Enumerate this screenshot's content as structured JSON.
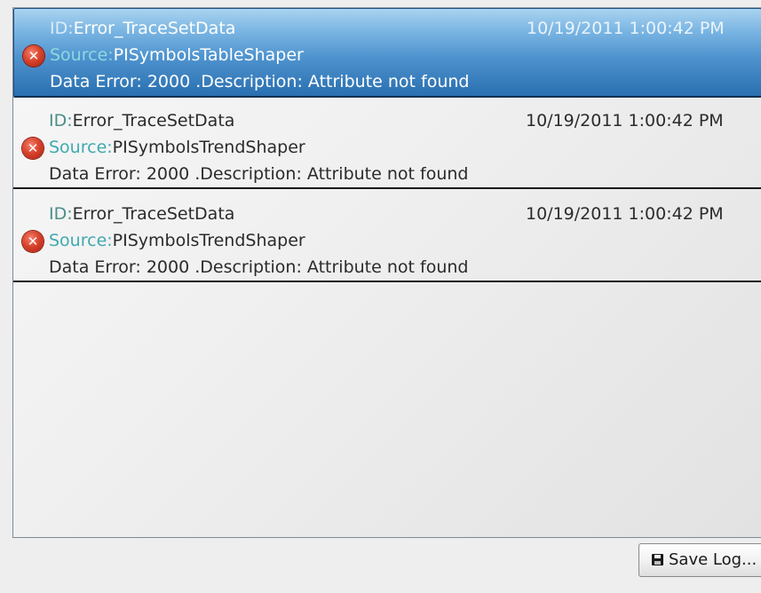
{
  "log": {
    "entries": [
      {
        "id_label": "ID:",
        "id_value": "Error_TraceSetData",
        "timestamp": "10/19/2011 1:00:42 PM",
        "source_label": "Source:",
        "source_value": "PISymbolsTableShaper",
        "description": "Data Error: 2000 .Description: Attribute not found",
        "selected": true,
        "icon": "error-icon"
      },
      {
        "id_label": "ID:",
        "id_value": "Error_TraceSetData",
        "timestamp": "10/19/2011 1:00:42 PM",
        "source_label": "Source:",
        "source_value": "PISymbolsTrendShaper",
        "description": "Data Error: 2000 .Description: Attribute not found",
        "selected": false,
        "icon": "error-icon"
      },
      {
        "id_label": "ID:",
        "id_value": "Error_TraceSetData",
        "timestamp": "10/19/2011 1:00:42 PM",
        "source_label": "Source:",
        "source_value": "PISymbolsTrendShaper",
        "description": "Data Error: 2000 .Description: Attribute not found",
        "selected": false,
        "icon": "error-icon"
      }
    ]
  },
  "footer": {
    "save_label": "Save Log...",
    "save_icon": "disk-icon"
  },
  "colors": {
    "selection": "#4f94cf",
    "error": "#d9432c",
    "label_teal": "#4a8f8a"
  }
}
